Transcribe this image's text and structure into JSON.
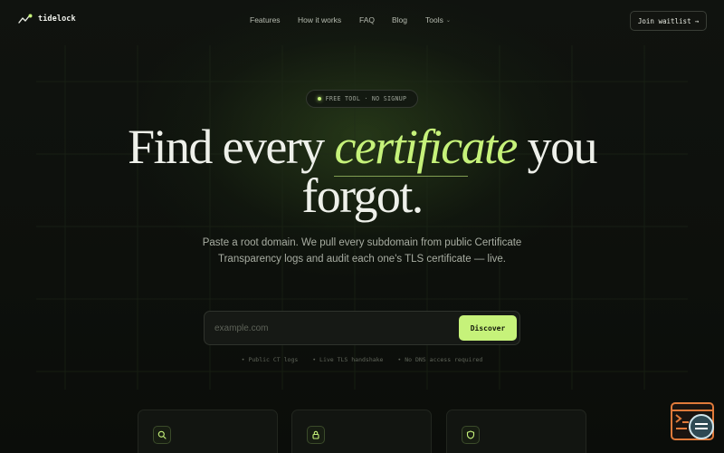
{
  "brand": {
    "name": "tidelock"
  },
  "nav": {
    "links": [
      "Features",
      "How it works",
      "FAQ",
      "Blog",
      "Tools"
    ],
    "cta": "Join waitlist",
    "cta_arrow": "→"
  },
  "hero": {
    "badge": "FREE TOOL · NO SIGNUP",
    "headline_before": "Find every ",
    "headline_accent": "certificate",
    "headline_after": " you",
    "headline_line2": "forgot.",
    "subtext": "Paste a root domain. We pull every subdomain from public Certificate Transparency logs and audit each one's TLS certificate — live."
  },
  "search": {
    "placeholder": "example.com",
    "value": "",
    "button": "Discover"
  },
  "features": [
    "• Public CT logs",
    "• Live TLS handshake",
    "• No DNS access required"
  ],
  "cards": [
    {
      "icon": "search-icon"
    },
    {
      "icon": "lock-icon"
    },
    {
      "icon": "shield-icon"
    }
  ],
  "colors": {
    "accent": "#c6f27a",
    "background": "#0c0e0b",
    "widget": "#e07a3a"
  }
}
